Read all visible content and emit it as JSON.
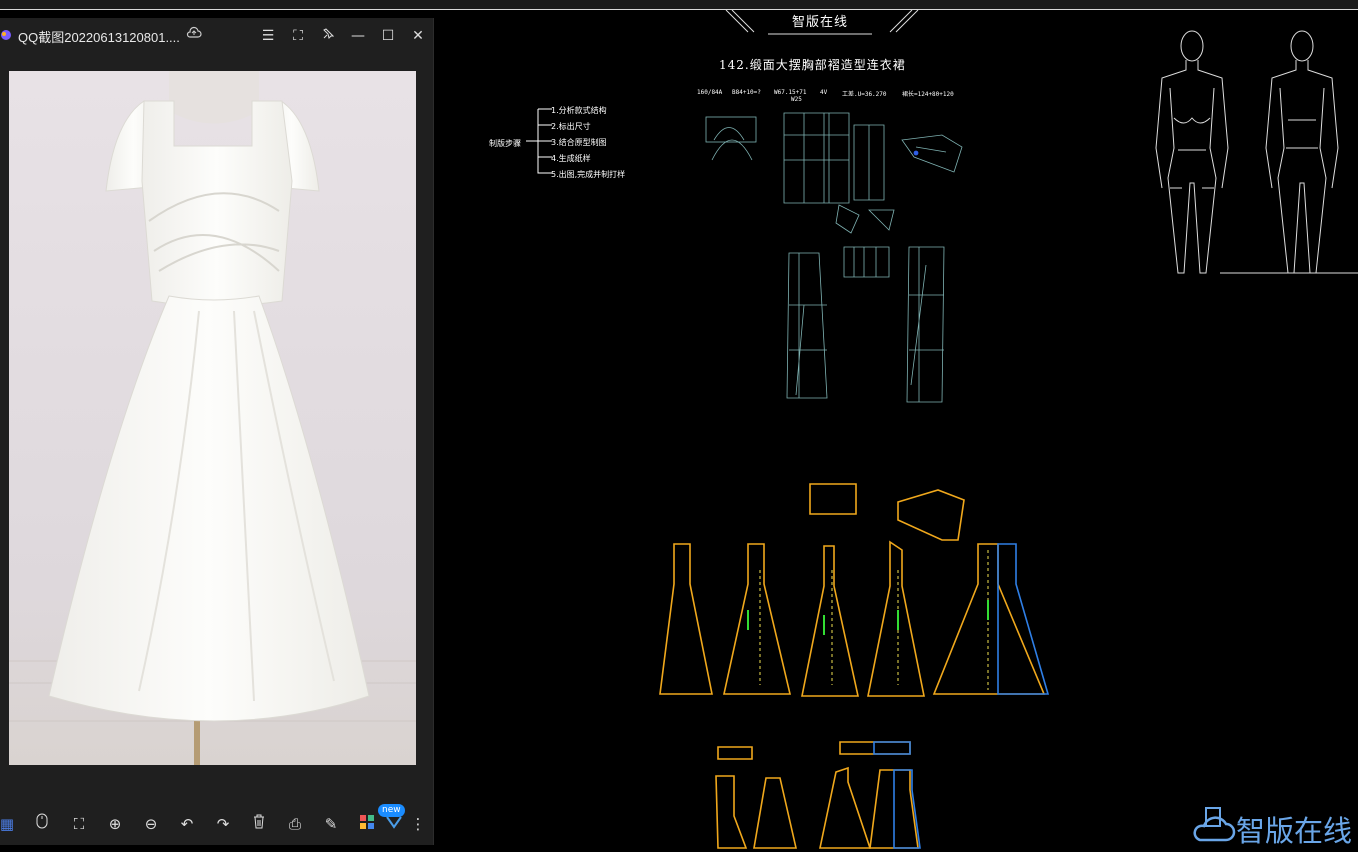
{
  "viewer": {
    "title": "QQ截图20220613120801....",
    "toolbar_new_badge": "new",
    "icons": [
      "grid-icon",
      "mouse-icon",
      "fit-screen-icon",
      "zoom-in-icon",
      "zoom-out-icon",
      "rotate-left-icon",
      "rotate-right-icon",
      "delete-icon",
      "print-icon",
      "edit-icon",
      "apps-icon",
      "more-icon"
    ]
  },
  "canvas": {
    "banner": "智版在线",
    "drawing_title": "142.缎面大摆胸部褶造型连衣裙",
    "steps_label": "制版步骤",
    "steps": [
      "1.分析款式结构",
      "2.标出尺寸",
      "3.结合原型制图",
      "4.生成纸样",
      "5.出图,完成并制打样"
    ],
    "measurements": [
      "160/84A",
      "B84+10=?",
      "W67.15+71",
      "4V",
      "工差.U=36.270",
      "裙长=124+80+120"
    ],
    "measurement_sub": "W25"
  },
  "watermark": {
    "text": "智版在线"
  },
  "colors": {
    "pattern_outline": "#f0a81c",
    "pattern_blue": "#2f7fe6",
    "draft_line": "#7fb3b3",
    "grain_text": "#33dd33"
  }
}
